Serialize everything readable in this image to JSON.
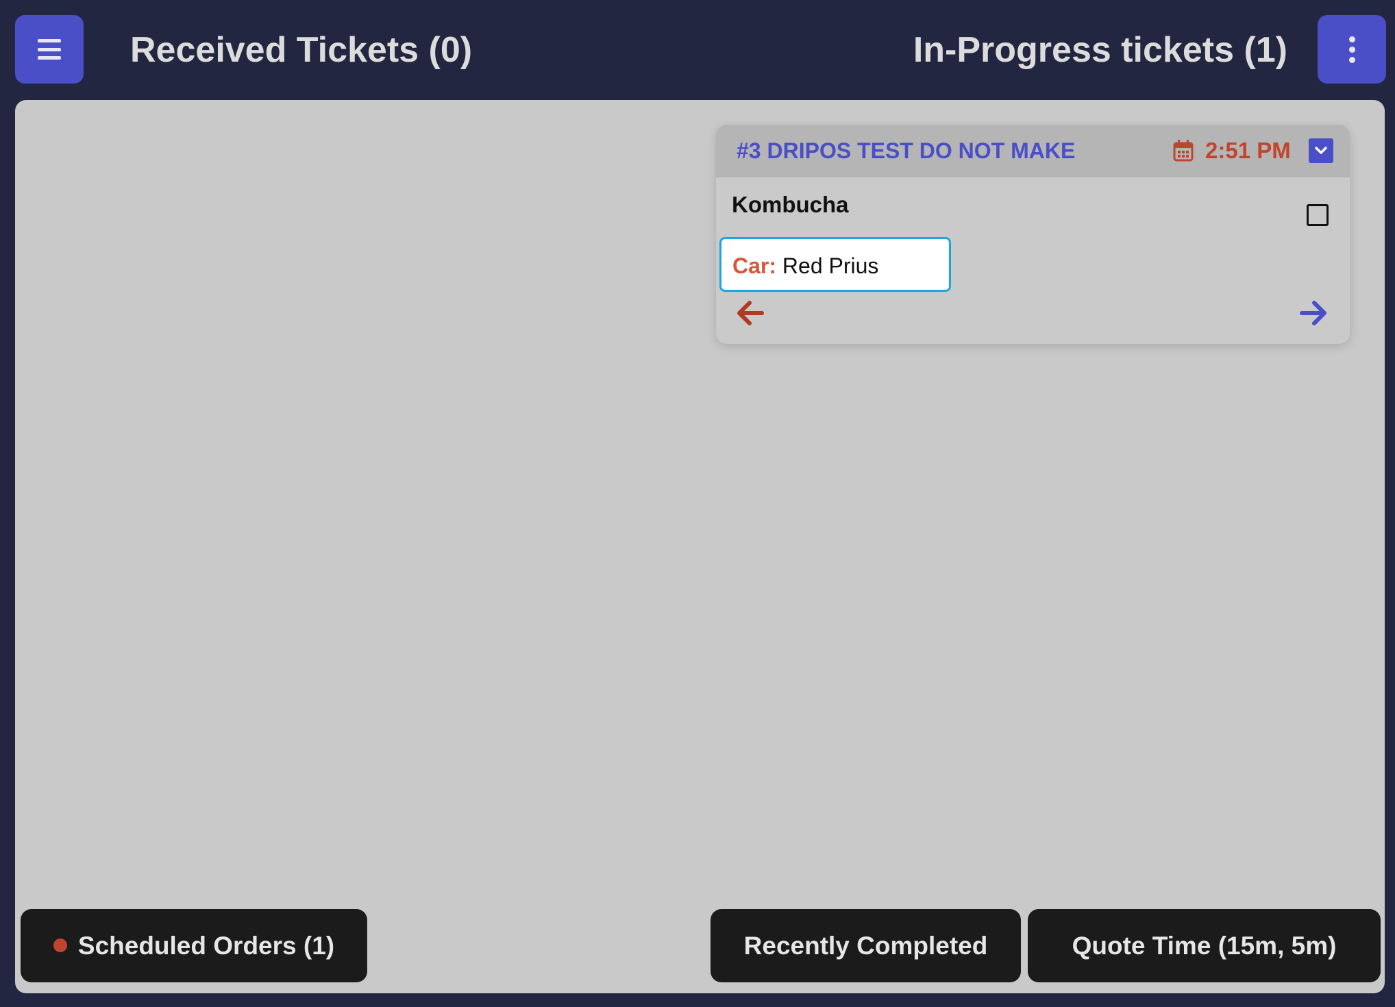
{
  "header": {
    "received_title": "Received Tickets (0)",
    "inprogress_title": "In-Progress tickets (1)"
  },
  "ticket": {
    "name": "#3 DRIPOS TEST DO NOT MAKE",
    "time": "2:51 PM",
    "item": "Kombucha",
    "item_checked": false,
    "car_label": "Car:",
    "car_value": "Red Prius"
  },
  "footer": {
    "scheduled_label": "Scheduled Orders (1)",
    "recent_label": "Recently Completed",
    "quote_label": "Quote Time (15m, 5m)"
  },
  "icons": {
    "menu": "hamburger-icon",
    "more": "kebab-icon",
    "calendar": "calendar-icon",
    "collapse": "chevron-down-icon",
    "back": "arrow-left-icon",
    "forward": "arrow-right-icon"
  },
  "colors": {
    "background": "#222640",
    "board": "#c9c9c9",
    "accent": "#4a4fc7",
    "warning": "#c0452f",
    "focus": "#1aa7e0",
    "footer_button": "#1b1b1b"
  }
}
